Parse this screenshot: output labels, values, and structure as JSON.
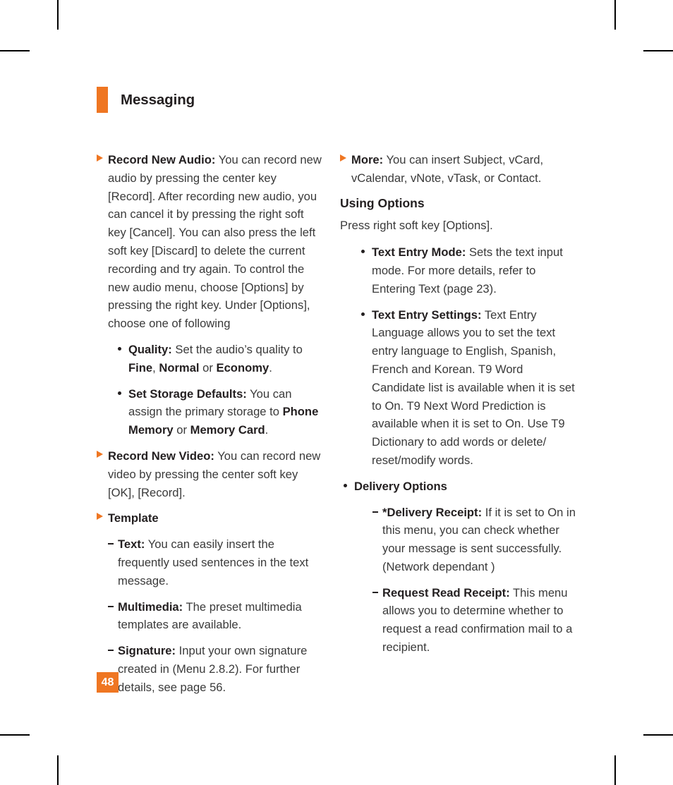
{
  "page": {
    "number": "48",
    "header_title": "Messaging",
    "accent_color": "#ef7622",
    "text_color": "#3a3a3a"
  },
  "left_column": {
    "items": [
      {
        "level": 1,
        "marker": "triangle",
        "term": "Record New Audio:",
        "body": " You can record new audio by pressing the center key [Record]. After recording new audio, you can cancel it by pressing the right soft key [Cancel]. You can also press the left soft key [Discard] to delete the current recording and try again. To control the new audio menu, choose [Options] by pressing the right key. Under [Options], choose one of following"
      },
      {
        "level": 2,
        "marker": "bullet",
        "term": "Quality:",
        "body_parts": [
          {
            "text": " Set the audio’s quality to ",
            "bold": false
          },
          {
            "text": "Fine",
            "bold": true
          },
          {
            "text": ", ",
            "bold": false
          },
          {
            "text": "Normal",
            "bold": true
          },
          {
            "text": " or ",
            "bold": false
          },
          {
            "text": "Economy",
            "bold": true
          },
          {
            "text": ".",
            "bold": false
          }
        ]
      },
      {
        "level": 2,
        "marker": "bullet",
        "term": "Set Storage Defaults:",
        "body_parts": [
          {
            "text": " You can assign the primary storage to ",
            "bold": false
          },
          {
            "text": "Phone Memory",
            "bold": true
          },
          {
            "text": " or ",
            "bold": false
          },
          {
            "text": "Memory Card",
            "bold": true
          },
          {
            "text": ".",
            "bold": false
          }
        ]
      },
      {
        "level": 1,
        "marker": "triangle",
        "term": "Record New Video:",
        "body": " You can record new video by pressing the center soft key [OK], [Record]."
      },
      {
        "level": 1,
        "marker": "triangle",
        "term": "Template",
        "body": ""
      },
      {
        "level": 3,
        "marker": "dash",
        "term": "Text:",
        "body": " You can easily insert the frequently used sentences in the text message."
      },
      {
        "level": 3,
        "marker": "dash",
        "term": "Multimedia:",
        "body": " The preset multimedia templates are available."
      },
      {
        "level": 3,
        "marker": "dash",
        "term": "Signature:",
        "body": " Input your own signature created in (Menu 2.8.2). For further details, see page 56."
      }
    ]
  },
  "right_column": {
    "items": [
      {
        "level": 1,
        "marker": "triangle",
        "term": "More:",
        "body": " You can insert Subject, vCard, vCalendar, vNote, vTask, or Contact."
      },
      {
        "level": 0,
        "marker": "heading",
        "term": "Using Options",
        "body": ""
      },
      {
        "level": 0,
        "marker": "none",
        "term": "",
        "body": "Press right soft key [Options]."
      },
      {
        "level": 2,
        "marker": "bullet",
        "term": "Text Entry Mode:",
        "body": " Sets the text input mode. For more details, refer to Entering Text (page 23)."
      },
      {
        "level": 2,
        "marker": "bullet",
        "term": "Text Entry Settings:",
        "body": " Text Entry Language allows you to set the text entry language to English, Spanish, French and Korean. T9 Word Candidate list is available when it is set to On. T9 Next Word Prediction is available when it is set to On. Use T9 Dictionary to add words or delete/ reset/modify words."
      },
      {
        "level": 2,
        "marker": "bullet-outdent",
        "term": "Delivery Options",
        "body": ""
      },
      {
        "level": 3,
        "marker": "dash-deep",
        "term": "*Delivery Receipt:",
        "body": " If it is set to On in this menu, you can check whether your message is sent successfully. (Network dependant )"
      },
      {
        "level": 3,
        "marker": "dash-deep",
        "term": "Request Read Receipt:",
        "body": " This menu allows you to determine whether to request a read confirmation mail to a recipient."
      }
    ]
  }
}
